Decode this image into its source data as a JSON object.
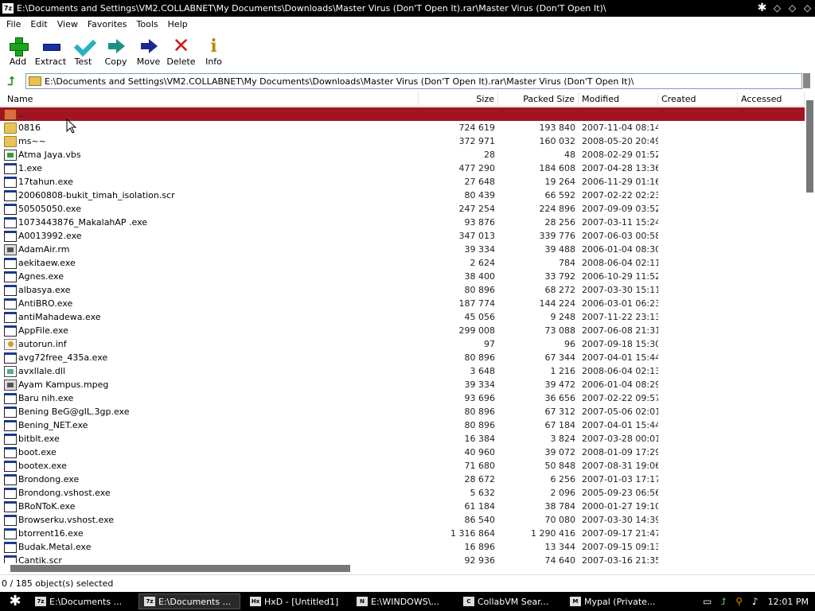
{
  "window": {
    "title": "E:\\Documents and Settings\\VM2.COLLABNET\\My Documents\\Downloads\\Master Virus (Don'T Open It).rar\\Master Virus (Don'T Open It)\\",
    "app_icon_text": "7z"
  },
  "menu": [
    "File",
    "Edit",
    "View",
    "Favorites",
    "Tools",
    "Help"
  ],
  "toolbar": [
    {
      "label": "Add",
      "icon": "add-icon"
    },
    {
      "label": "Extract",
      "icon": "extract-icon"
    },
    {
      "label": "Test",
      "icon": "test-icon"
    },
    {
      "label": "Copy",
      "icon": "copy-icon"
    },
    {
      "label": "Move",
      "icon": "move-icon"
    },
    {
      "label": "Delete",
      "icon": "delete-icon"
    },
    {
      "label": "Info",
      "icon": "info-icon"
    }
  ],
  "address": {
    "path": "E:\\Documents and Settings\\VM2.COLLABNET\\My Documents\\Downloads\\Master Virus (Don'T Open It).rar\\Master Virus (Don'T Open It)\\"
  },
  "columns": [
    "Name",
    "Size",
    "Packed Size",
    "Modified",
    "Created",
    "Accessed"
  ],
  "files": [
    {
      "name": "..",
      "type": "folder",
      "size": "",
      "packed": "",
      "modified": "",
      "selected": true
    },
    {
      "name": "0816",
      "type": "folder",
      "size": "724 619",
      "packed": "193 840",
      "modified": "2007-11-04 08:14"
    },
    {
      "name": "ms~~",
      "type": "folder",
      "size": "372 971",
      "packed": "160 032",
      "modified": "2008-05-20 20:49"
    },
    {
      "name": "Atma Jaya.vbs",
      "type": "script",
      "size": "28",
      "packed": "48",
      "modified": "2008-02-29 01:52"
    },
    {
      "name": "1.exe",
      "type": "exe",
      "size": "477 290",
      "packed": "184 608",
      "modified": "2007-04-28 13:36"
    },
    {
      "name": "17tahun.exe",
      "type": "exe",
      "size": "27 648",
      "packed": "19 264",
      "modified": "2006-11-29 01:16"
    },
    {
      "name": "20060808-bukit_timah_isolation.scr",
      "type": "exe",
      "size": "80 439",
      "packed": "66 592",
      "modified": "2007-02-22 02:23"
    },
    {
      "name": "50505050.exe",
      "type": "exe",
      "size": "247 254",
      "packed": "224 896",
      "modified": "2007-09-09 03:52"
    },
    {
      "name": "1073443876_MakalahAP .exe",
      "type": "exe",
      "size": "93 876",
      "packed": "28 256",
      "modified": "2007-03-11 15:24"
    },
    {
      "name": "A0013992.exe",
      "type": "exe",
      "size": "347 013",
      "packed": "339 776",
      "modified": "2007-06-03 00:58"
    },
    {
      "name": "AdamAir.rm",
      "type": "media",
      "size": "39 334",
      "packed": "39 488",
      "modified": "2006-01-04 08:30"
    },
    {
      "name": "aekitaew.exe",
      "type": "exe",
      "size": "2 624",
      "packed": "784",
      "modified": "2008-06-04 02:11"
    },
    {
      "name": "Agnes.exe",
      "type": "exe",
      "size": "38 400",
      "packed": "33 792",
      "modified": "2006-10-29 11:52"
    },
    {
      "name": "albasya.exe",
      "type": "exe",
      "size": "80 896",
      "packed": "68 272",
      "modified": "2007-03-30 15:11"
    },
    {
      "name": "AntiBRO.exe",
      "type": "exe",
      "size": "187 774",
      "packed": "144 224",
      "modified": "2006-03-01 06:23"
    },
    {
      "name": "antiMahadewa.exe",
      "type": "exe",
      "size": "45 056",
      "packed": "9 248",
      "modified": "2007-11-22 23:13"
    },
    {
      "name": "AppFile.exe",
      "type": "exe",
      "size": "299 008",
      "packed": "73 088",
      "modified": "2007-06-08 21:31"
    },
    {
      "name": "autorun.inf",
      "type": "settings",
      "size": "97",
      "packed": "96",
      "modified": "2007-09-18 15:30"
    },
    {
      "name": "avg72free_435a.exe",
      "type": "exe",
      "size": "80 896",
      "packed": "67 344",
      "modified": "2007-04-01 15:44"
    },
    {
      "name": "avxllale.dll",
      "type": "dll",
      "size": "3 648",
      "packed": "1 216",
      "modified": "2008-06-04 02:13"
    },
    {
      "name": "Ayam Kampus.mpeg",
      "type": "media",
      "size": "39 334",
      "packed": "39 472",
      "modified": "2006-01-04 08:29"
    },
    {
      "name": "Baru nih.exe",
      "type": "exe",
      "size": "93 696",
      "packed": "36 656",
      "modified": "2007-02-22 09:57"
    },
    {
      "name": "Bening BeG@gIL.3gp.exe",
      "type": "exe",
      "size": "80 896",
      "packed": "67 312",
      "modified": "2007-05-06 02:01"
    },
    {
      "name": "Bening_NET.exe",
      "type": "exe",
      "size": "80 896",
      "packed": "67 184",
      "modified": "2007-04-01 15:44"
    },
    {
      "name": "bitblt.exe",
      "type": "exe",
      "size": "16 384",
      "packed": "3 824",
      "modified": "2007-03-28 00:01"
    },
    {
      "name": "boot.exe",
      "type": "exe",
      "size": "40 960",
      "packed": "39 072",
      "modified": "2008-01-09 17:29"
    },
    {
      "name": "bootex.exe",
      "type": "exe",
      "size": "71 680",
      "packed": "50 848",
      "modified": "2007-08-31 19:06"
    },
    {
      "name": "Brondong.exe",
      "type": "exe",
      "size": "28 672",
      "packed": "6 256",
      "modified": "2007-01-03 17:17"
    },
    {
      "name": "Brondong.vshost.exe",
      "type": "exe",
      "size": "5 632",
      "packed": "2 096",
      "modified": "2005-09-23 06:56"
    },
    {
      "name": "BRoNToK.exe",
      "type": "exe",
      "size": "61 184",
      "packed": "38 784",
      "modified": "2000-01-27 19:10"
    },
    {
      "name": "Browserku.vshost.exe",
      "type": "exe",
      "size": "86 540",
      "packed": "70 080",
      "modified": "2007-03-30 14:39"
    },
    {
      "name": "btorrent16.exe",
      "type": "exe",
      "size": "1 316 864",
      "packed": "1 290 416",
      "modified": "2007-09-17 21:47"
    },
    {
      "name": "Budak.Metal.exe",
      "type": "exe",
      "size": "16 896",
      "packed": "13 344",
      "modified": "2007-09-15 09:13"
    },
    {
      "name": "Cantik.scr",
      "type": "exe",
      "size": "92 936",
      "packed": "74 640",
      "modified": "2007-03-16 21:35"
    }
  ],
  "status": {
    "text": "0 / 185 object(s) selected"
  },
  "taskbar": {
    "tasks": [
      {
        "label": "E:\\Documents ...",
        "icon": "7z",
        "active": false
      },
      {
        "label": "E:\\Documents ...",
        "icon": "7z",
        "active": true
      },
      {
        "label": "HxD - [Untitled1]",
        "icon": "Hx",
        "active": false
      },
      {
        "label": "E:\\WINDOWS\\...",
        "icon": "N",
        "active": false
      },
      {
        "label": "CollabVM Sear...",
        "icon": "C",
        "active": false
      },
      {
        "label": "Mypal (Private...",
        "icon": "M",
        "active": false
      }
    ],
    "clock": "12:01 PM"
  }
}
